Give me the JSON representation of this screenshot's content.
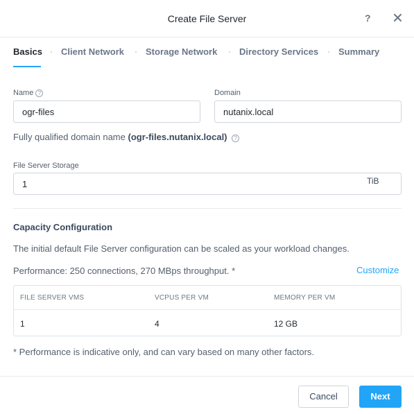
{
  "dialog": {
    "title": "Create File Server",
    "help_glyph": "?"
  },
  "tabs": [
    {
      "label": "Basics",
      "active": true
    },
    {
      "label": "Client Network",
      "active": false
    },
    {
      "label": "Storage Network",
      "active": false
    },
    {
      "label": "Directory Services",
      "active": false
    },
    {
      "label": "Summary",
      "active": false
    }
  ],
  "form": {
    "name_label": "Name",
    "name_value": "ogr-files",
    "domain_label": "Domain",
    "domain_value": "nutanix.local",
    "fqdn_prefix": "Fully qualified domain name",
    "fqdn_value": "(ogr-files.nutanix.local)",
    "storage_label": "File Server Storage",
    "storage_value": "1",
    "storage_unit": "TiB"
  },
  "capacity": {
    "title": "Capacity Configuration",
    "description": "The initial default File Server configuration can be scaled as your workload changes.",
    "performance": "Performance: 250 connections, 270 MBps throughput. *",
    "customize_label": "Customize",
    "table": {
      "headers": [
        "FILE SERVER VMS",
        "VCPUS PER VM",
        "MEMORY PER VM"
      ],
      "row": [
        "1",
        "4",
        "12 GB"
      ]
    },
    "footnote": "* Performance is indicative only, and can vary based on many other factors."
  },
  "footer": {
    "cancel_label": "Cancel",
    "next_label": "Next"
  },
  "colors": {
    "accent": "#22a5f7"
  }
}
